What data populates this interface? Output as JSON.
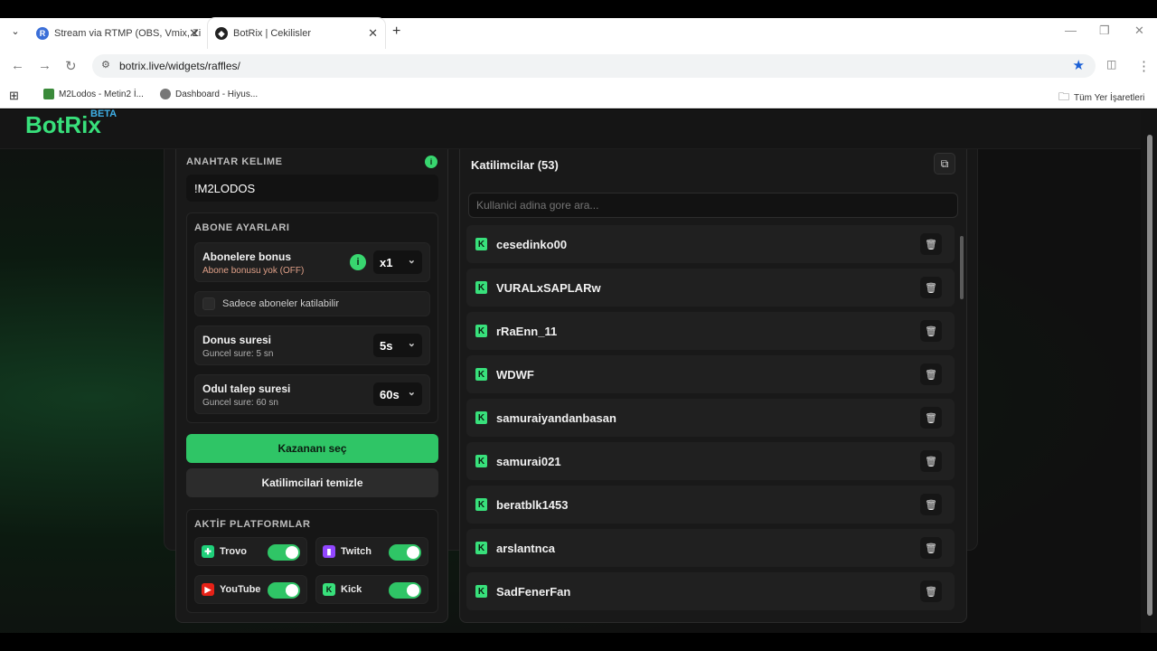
{
  "browser": {
    "tabs": [
      {
        "title": "Stream via RTMP (OBS, Vmix, Zi",
        "active": false,
        "icon": "R"
      },
      {
        "title": "BotRix | Cekilisler",
        "active": true,
        "icon": "botrix"
      }
    ],
    "url": "botrix.live/widgets/raffles/",
    "bookmarks": [
      {
        "label": "M2Lodos - Metin2 İ..."
      },
      {
        "label": "Dashboard - Hiyus..."
      }
    ],
    "bookmarks_folder": "Tüm Yer İşaretleri"
  },
  "app": {
    "logo": "BotRix",
    "beta": "BETA"
  },
  "settings": {
    "keyword_label": "ANAHTAR KELIME",
    "keyword_value": "!M2LODOS",
    "sub_settings_label": "ABONE AYARLARI",
    "sub_bonus_title": "Abonelere bonus",
    "sub_bonus_sub": "Abone bonusu yok (OFF)",
    "sub_bonus_value": "x1",
    "subs_only_label": "Sadece aboneler katilabilir",
    "return_title": "Donus suresi",
    "return_sub": "Guncel sure: 5 sn",
    "return_value": "5s",
    "claim_title": "Odul talep suresi",
    "claim_sub": "Guncel sure: 60 sn",
    "claim_value": "60s",
    "pick_winner": "Kazananı seç",
    "clear_participants": "Katilimcilari temizle",
    "platforms_label": "AKTİF PLATFORMLAR",
    "platforms": [
      {
        "name": "Trovo",
        "color": "#1fd07a",
        "enabled": true
      },
      {
        "name": "Twitch",
        "color": "#9146ff",
        "enabled": true
      },
      {
        "name": "YouTube",
        "color": "#e62117",
        "enabled": true
      },
      {
        "name": "Kick",
        "color": "#38e07b",
        "enabled": true
      }
    ]
  },
  "participants": {
    "title": "Katilimcilar (53)",
    "search_placeholder": "Kullanici adina gore ara...",
    "items": [
      "cesedinko00",
      "VURALxSAPLARw",
      "rRaEnn_11",
      "WDWF",
      "samuraiyandanbasan",
      "samurai021",
      "beratblk1453",
      "arslantnca",
      "SadFenerFan"
    ]
  },
  "colors": {
    "accent": "#2fc566",
    "logo": "#38e07b",
    "beta": "#3fb0e8"
  }
}
